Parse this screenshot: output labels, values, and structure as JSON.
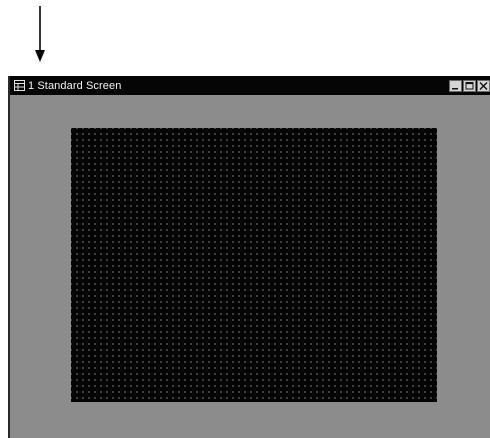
{
  "window": {
    "title": "1 Standard Screen",
    "icon": "screen-grid-icon",
    "controls": [
      "minimize-icon",
      "maximize-icon",
      "close-icon"
    ]
  },
  "colors": {
    "title_bar": "#050505",
    "title_text": "#f4f4f4",
    "window_body": "#8c8c8c",
    "canvas": "#050505",
    "grid_dot": "#4a4a4a"
  },
  "pointer": {
    "icon": "down-arrow-icon"
  }
}
